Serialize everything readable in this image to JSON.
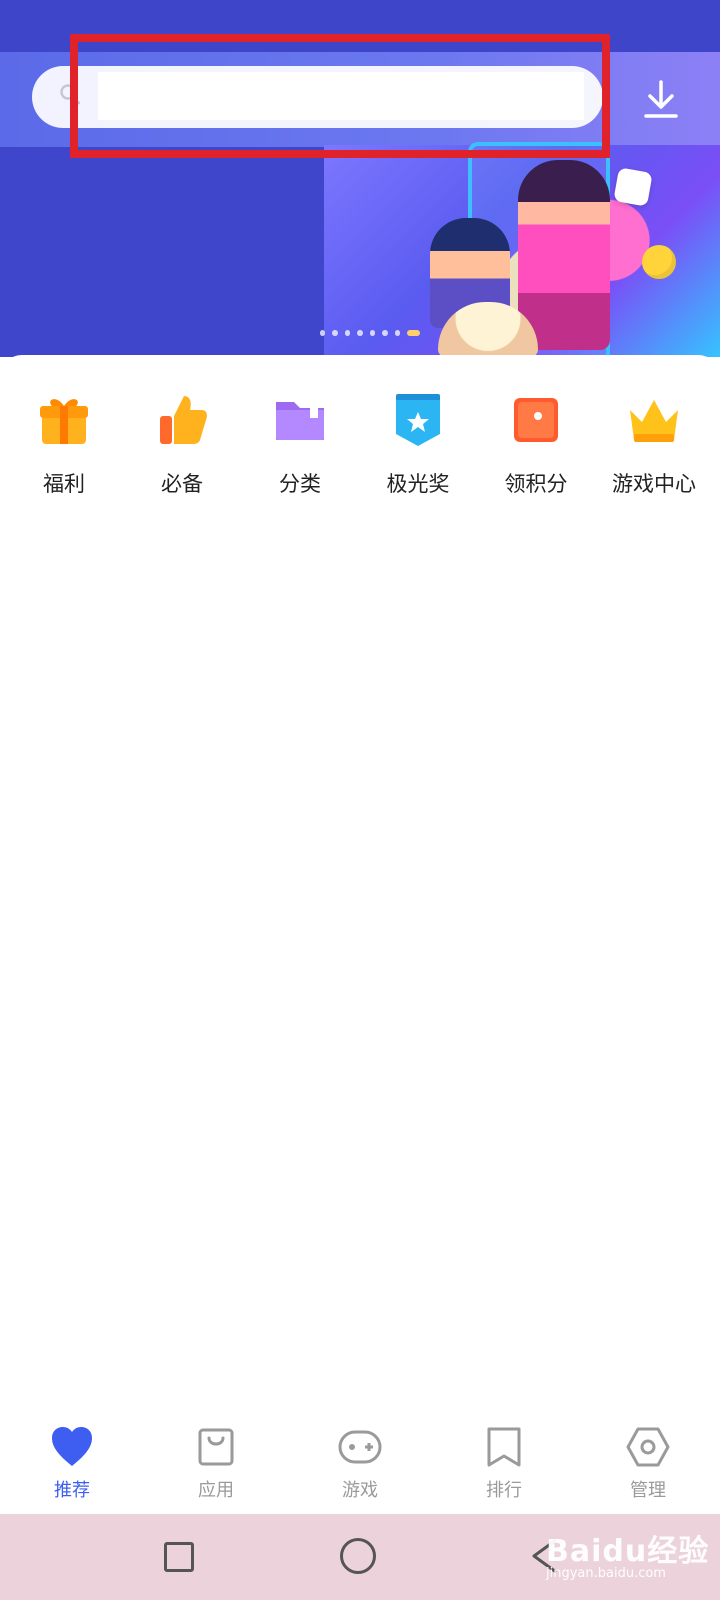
{
  "search": {
    "placeholder": "",
    "value": ""
  },
  "quick_actions": [
    {
      "label": "福利",
      "icon": "gift-icon"
    },
    {
      "label": "必备",
      "icon": "thumbs-up-icon"
    },
    {
      "label": "分类",
      "icon": "folder-icon"
    },
    {
      "label": "极光奖",
      "icon": "award-shield-icon"
    },
    {
      "label": "领积分",
      "icon": "points-card-icon"
    },
    {
      "label": "游戏中心",
      "icon": "crown-icon"
    }
  ],
  "bottom_tabs": [
    {
      "label": "推荐",
      "icon": "heart-icon",
      "active": true
    },
    {
      "label": "应用",
      "icon": "shopping-bag-icon",
      "active": false
    },
    {
      "label": "游戏",
      "icon": "gamepad-icon",
      "active": false
    },
    {
      "label": "排行",
      "icon": "bookmark-icon",
      "active": false
    },
    {
      "label": "管理",
      "icon": "hexagon-settings-icon",
      "active": false
    }
  ],
  "watermark": {
    "brand": "Baidu经验",
    "url": "jingyan.baidu.com"
  },
  "colors": {
    "accent": "#3d5ef0",
    "header": "#3f46cb",
    "highlight": "#e0232b",
    "system_nav": "#ecd3db"
  }
}
